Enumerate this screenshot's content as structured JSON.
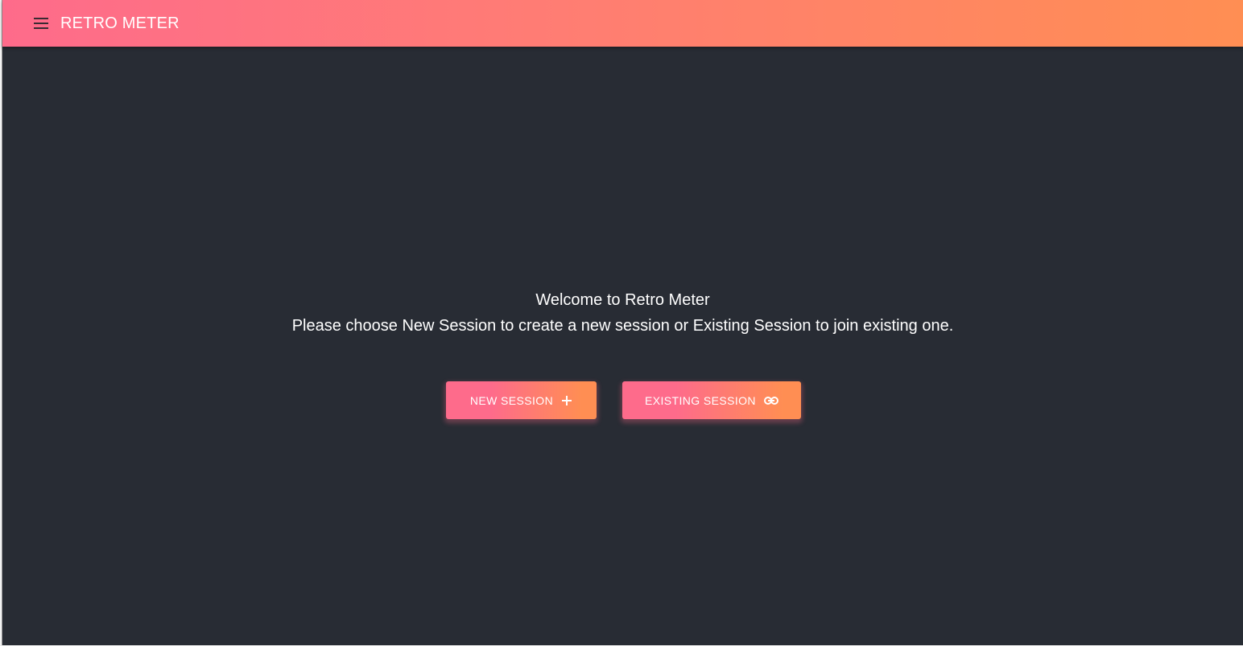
{
  "appbar": {
    "title": "RETRO METER",
    "menu_icon": "menu-icon",
    "gradient": [
      "#fe6b8b",
      "#ff8e53"
    ]
  },
  "main": {
    "background": "#282c34",
    "welcome_title": "Welcome to Retro Meter",
    "welcome_subtitle": "Please choose New Session to create a new session or Existing Session to join existing one."
  },
  "actions": {
    "new_session": {
      "label": "NEW SESSION",
      "icon": "plus-icon"
    },
    "existing_session": {
      "label": "EXISTING SESSION",
      "icon": "link-icon"
    }
  }
}
